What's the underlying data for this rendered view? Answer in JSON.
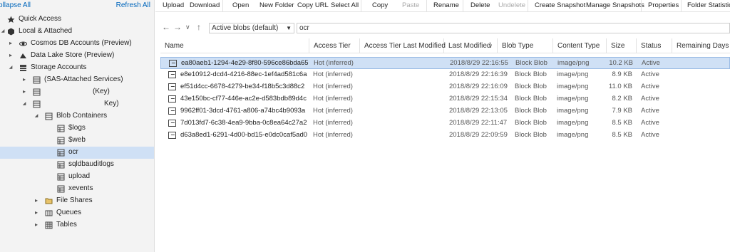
{
  "left_panel": {
    "collapse_all": "ollapse All",
    "refresh_all": "Refresh All",
    "tree": [
      {
        "label": "Quick Access",
        "icon": "quick-access-icon",
        "arrow": ""
      },
      {
        "label": "Local & Attached",
        "icon": "local-attached-icon",
        "arrow": "chevron-down-icon"
      },
      {
        "label": "Cosmos DB Accounts (Preview)",
        "icon": "cosmos-icon",
        "arrow": "chevron-right-icon"
      },
      {
        "label": "Data Lake Store (Preview)",
        "icon": "datalake-icon",
        "arrow": "chevron-right-icon"
      },
      {
        "label": "Storage Accounts",
        "icon": "storage-icon",
        "arrow": "chevron-down-icon"
      },
      {
        "label": "(SAS-Attached Services)",
        "icon": "storage-account-icon",
        "arrow": "chevron-right-icon"
      },
      {
        "label": "(Key)",
        "icon": "storage-account-icon",
        "arrow": "chevron-right-icon"
      },
      {
        "label": "Key)",
        "icon": "storage-account-icon",
        "arrow": "chevron-down-icon"
      },
      {
        "label": "Blob Containers",
        "icon": "blob-containers-icon",
        "arrow": "chevron-down-icon"
      },
      {
        "label": "$logs",
        "icon": "container-icon",
        "arrow": ""
      },
      {
        "label": "$web",
        "icon": "container-icon",
        "arrow": ""
      },
      {
        "label": "ocr",
        "icon": "container-icon",
        "arrow": ""
      },
      {
        "label": "sqldbauditlogs",
        "icon": "container-icon",
        "arrow": ""
      },
      {
        "label": "upload",
        "icon": "container-icon",
        "arrow": ""
      },
      {
        "label": "xevents",
        "icon": "container-icon",
        "arrow": ""
      },
      {
        "label": "File Shares",
        "icon": "file-shares-icon",
        "arrow": "chevron-right-icon"
      },
      {
        "label": "Queues",
        "icon": "queues-icon",
        "arrow": "chevron-right-icon"
      },
      {
        "label": "Tables",
        "icon": "tables-icon",
        "arrow": "chevron-right-icon"
      }
    ]
  },
  "toolbar": {
    "upload": "Upload",
    "download": "Download",
    "open": "Open",
    "new_folder": "New Folder",
    "copy_url": "Copy URL",
    "select_all": "Select All",
    "copy": "Copy",
    "paste": "Paste",
    "rename": "Rename",
    "delete": "Delete",
    "undelete": "Undelete",
    "create_snapshot": "Create Snapshot",
    "manage_snapshots": "Manage Snapshots",
    "properties": "Properties",
    "folder_statistics": "Folder Statistics"
  },
  "nav": {
    "filter_selected": "Active blobs (default)",
    "path": "ocr"
  },
  "table": {
    "headers": [
      "Name",
      "Access Tier",
      "Access Tier Last Modified",
      "Last Modified",
      "Blob Type",
      "Content Type",
      "Size",
      "Status",
      "Remaining Days"
    ],
    "rows": [
      {
        "name": "ea80aeb1-1294-4e29-8f80-596ce86bda65",
        "tier": "Hot (inferred)",
        "tier_modified": "",
        "modified": "2018/8/29 22:16:55",
        "blob_type": "Block Blob",
        "content_type": "image/png",
        "size": "10.2 KB",
        "status": "Active",
        "remaining": ""
      },
      {
        "name": "e8e10912-dcd4-4216-88ec-1ef4ad581c6a",
        "tier": "Hot (inferred)",
        "tier_modified": "",
        "modified": "2018/8/29 22:16:39",
        "blob_type": "Block Blob",
        "content_type": "image/png",
        "size": "8.9 KB",
        "status": "Active",
        "remaining": ""
      },
      {
        "name": "ef51d4cc-6678-4279-be34-f18b5c3d88c2",
        "tier": "Hot (inferred)",
        "tier_modified": "",
        "modified": "2018/8/29 22:16:09",
        "blob_type": "Block Blob",
        "content_type": "image/png",
        "size": "11.0 KB",
        "status": "Active",
        "remaining": ""
      },
      {
        "name": "43e150bc-cf77-446e-ac2e-d583bdb89d4c",
        "tier": "Hot (inferred)",
        "tier_modified": "",
        "modified": "2018/8/29 22:15:34",
        "blob_type": "Block Blob",
        "content_type": "image/png",
        "size": "8.2 KB",
        "status": "Active",
        "remaining": ""
      },
      {
        "name": "9962ff01-3dcd-4761-a806-a74bc4b9093a",
        "tier": "Hot (inferred)",
        "tier_modified": "",
        "modified": "2018/8/29 22:13:05",
        "blob_type": "Block Blob",
        "content_type": "image/png",
        "size": "7.9 KB",
        "status": "Active",
        "remaining": ""
      },
      {
        "name": "7d013fd7-6c38-4ea9-9bba-0c8ea64c27a2",
        "tier": "Hot (inferred)",
        "tier_modified": "",
        "modified": "2018/8/29 22:11:47",
        "blob_type": "Block Blob",
        "content_type": "image/png",
        "size": "8.5 KB",
        "status": "Active",
        "remaining": ""
      },
      {
        "name": "d63a8ed1-6291-4d00-bd15-e0dc0caf5ad0",
        "tier": "Hot (inferred)",
        "tier_modified": "",
        "modified": "2018/8/29 22:09:59",
        "blob_type": "Block Blob",
        "content_type": "image/png",
        "size": "8.5 KB",
        "status": "Active",
        "remaining": ""
      }
    ]
  },
  "colors": {
    "selection": "#cfe0f5",
    "link": "#0066bb",
    "panel_bg": "#f3f3f3"
  }
}
